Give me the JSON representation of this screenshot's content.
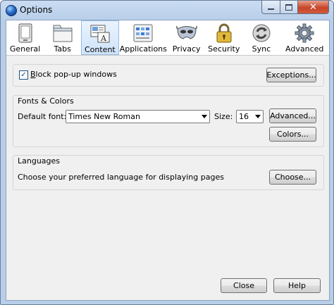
{
  "window": {
    "title": "Options"
  },
  "toolbar": {
    "tabs": [
      {
        "label": "General",
        "icon": "general-icon"
      },
      {
        "label": "Tabs",
        "icon": "tabs-icon"
      },
      {
        "label": "Content",
        "icon": "content-icon",
        "selected": true
      },
      {
        "label": "Applications",
        "icon": "applications-icon"
      },
      {
        "label": "Privacy",
        "icon": "privacy-mask-icon"
      },
      {
        "label": "Security",
        "icon": "lock-icon"
      },
      {
        "label": "Sync",
        "icon": "sync-icon"
      },
      {
        "label": "Advanced",
        "icon": "gear-icon"
      }
    ]
  },
  "content": {
    "popup": {
      "label": "Block pop-up windows",
      "checked": true,
      "exceptions_button": "Exceptions..."
    },
    "fonts": {
      "group_label": "Fonts & Colors",
      "default_font_label": "Default font:",
      "default_font_value": "Times New Roman",
      "size_label": "Size:",
      "size_value": "16",
      "advanced_button": "Advanced...",
      "colors_button": "Colors..."
    },
    "languages": {
      "group_label": "Languages",
      "description": "Choose your preferred language for displaying pages",
      "choose_button": "Choose..."
    }
  },
  "footer": {
    "close_button": "Close",
    "help_button": "Help"
  },
  "colors": {
    "selected_tab": "#cfe3fa",
    "titlebar": "#b7cde8",
    "close_button": "#c6452a"
  }
}
